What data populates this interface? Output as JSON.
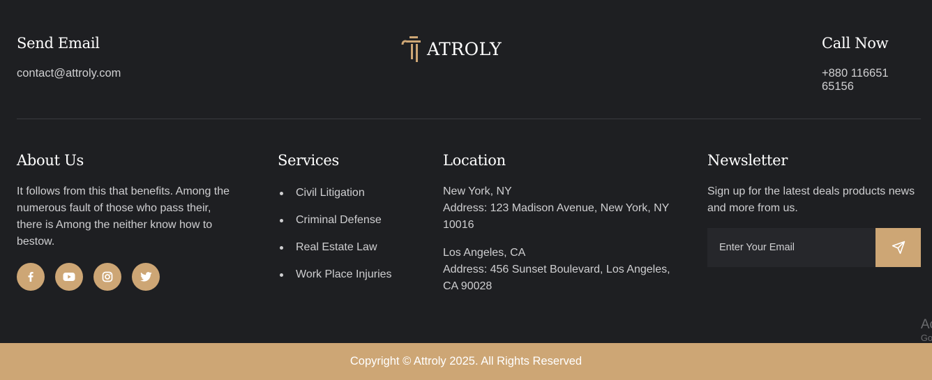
{
  "colors": {
    "background": "#1e1f22",
    "accent": "#cda675",
    "text": "#cfcfd1",
    "heading": "#ffffff"
  },
  "contact": {
    "email_heading": "Send Email",
    "email": "contact@attroly.com",
    "call_heading": "Call Now",
    "phone": "+880 116651 65156"
  },
  "logo": {
    "text": "ATROLY",
    "icon": "pillar-logo-icon"
  },
  "about": {
    "heading": "About Us",
    "text": "It follows from this that benefits. Among the numerous fault of those who pass their, there is Among the neither know how to bestow.",
    "socials": [
      {
        "name": "facebook",
        "icon": "facebook-icon"
      },
      {
        "name": "youtube",
        "icon": "youtube-icon"
      },
      {
        "name": "instagram",
        "icon": "instagram-icon"
      },
      {
        "name": "twitter",
        "icon": "twitter-icon"
      }
    ]
  },
  "services": {
    "heading": "Services",
    "items": [
      "Civil Litigation",
      "Criminal Defense",
      "Real Estate Law",
      "Work Place Injuries"
    ]
  },
  "location": {
    "heading": "Location",
    "offices": [
      {
        "city": "New York, NY",
        "address": "Address: 123 Madison Avenue, New York, NY 10016"
      },
      {
        "city": "Los Angeles, CA",
        "address": "Address: 456 Sunset Boulevard, Los Angeles, CA 90028"
      }
    ]
  },
  "newsletter": {
    "heading": "Newsletter",
    "text": "Sign up for the latest deals products news and more from us.",
    "placeholder": "Enter Your Email",
    "submit_icon": "send-icon"
  },
  "watermark": {
    "line1": "Ac",
    "line2": "Go"
  },
  "footer": {
    "copyright": "Copyright © Attroly 2025. All Rights Reserved"
  }
}
